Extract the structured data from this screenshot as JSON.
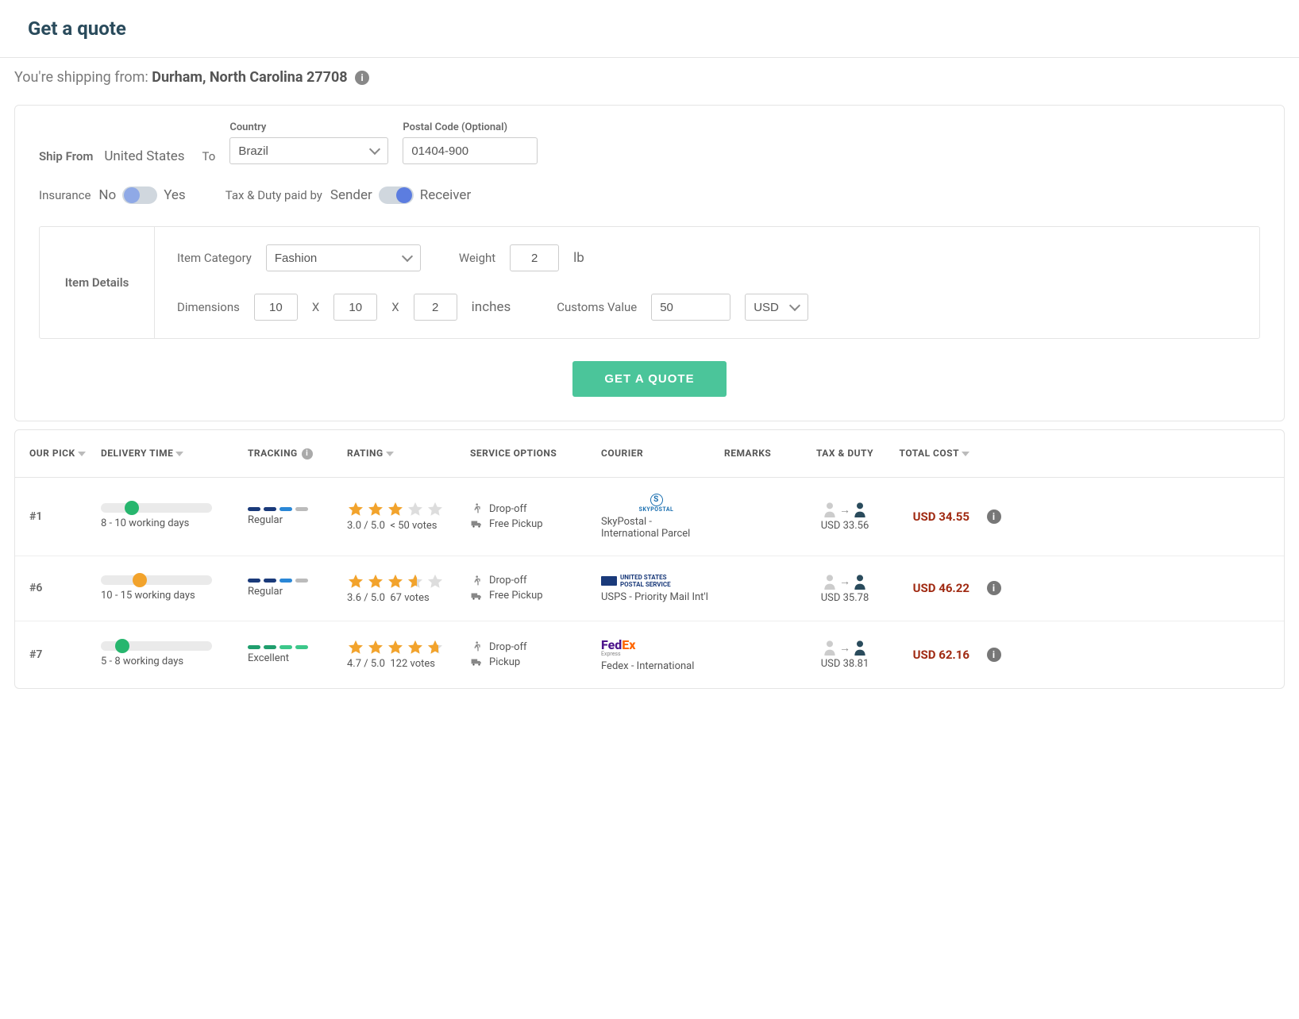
{
  "header": {
    "title": "Get a quote"
  },
  "shipFrom": {
    "prefix": "You're shipping from: ",
    "location": "Durham, North Carolina 27708"
  },
  "form": {
    "shipFromLabel": "Ship From",
    "shipFromValue": "United States",
    "toLabel": "To",
    "countryLabel": "Country",
    "countryValue": "Brazil",
    "postalLabel": "Postal Code (Optional)",
    "postalValue": "01404-900",
    "insuranceLabel": "Insurance",
    "insuranceNo": "No",
    "insuranceYes": "Yes",
    "taxDutyLabel": "Tax & Duty paid by",
    "taxDutySender": "Sender",
    "taxDutyReceiver": "Receiver",
    "itemDetailsLabel": "Item Details",
    "itemCategoryLabel": "Item Category",
    "itemCategoryValue": "Fashion",
    "weightLabel": "Weight",
    "weightValue": "2",
    "weightUnit": "lb",
    "dimensionsLabel": "Dimensions",
    "dimL": "10",
    "dimW": "10",
    "dimH": "2",
    "dimX": "X",
    "dimUnit": "inches",
    "customsValueLabel": "Customs Value",
    "customsValue": "50",
    "currency": "USD",
    "submitLabel": "GET A QUOTE"
  },
  "columns": {
    "pick": "OUR PICK",
    "time": "DELIVERY TIME",
    "tracking": "TRACKING",
    "rating": "RATING",
    "service": "SERVICE OPTIONS",
    "courier": "COURIER",
    "remarks": "REMARKS",
    "tax": "TAX & DUTY",
    "total": "TOTAL COST"
  },
  "rows": [
    {
      "pick": "#1",
      "deliveryText": "8 - 10 working days",
      "timeDotPos": 30,
      "timeDotColor": "#27b66e",
      "trackingSegs": [
        "#1a3a7a",
        "#1a3a7a",
        "#2a87d6",
        "#bbb"
      ],
      "trackingText": "Regular",
      "ratingStars": 3.0,
      "ratingText": "3.0 / 5.0",
      "ratingVotes": "< 50 votes",
      "svc1": "Drop-off",
      "svc2": "Free Pickup",
      "courierLogo": "skypostal",
      "courierName": "SkyPostal - International Parcel",
      "taxAmount": "USD 33.56",
      "total": "USD 34.55"
    },
    {
      "pick": "#6",
      "deliveryText": "10 - 15 working days",
      "timeDotPos": 40,
      "timeDotColor": "#f2a32c",
      "trackingSegs": [
        "#1a3a7a",
        "#1a3a7a",
        "#2a87d6",
        "#bbb"
      ],
      "trackingText": "Regular",
      "ratingStars": 3.6,
      "ratingText": "3.6 / 5.0",
      "ratingVotes": "67 votes",
      "svc1": "Drop-off",
      "svc2": "Free Pickup",
      "courierLogo": "usps",
      "courierName": "USPS - Priority Mail Int'l",
      "taxAmount": "USD 35.78",
      "total": "USD 46.22"
    },
    {
      "pick": "#7",
      "deliveryText": "5 - 8 working days",
      "timeDotPos": 18,
      "timeDotColor": "#27b66e",
      "trackingSegs": [
        "#1f9e6d",
        "#1f9e6d",
        "#3cc78a",
        "#3cc78a"
      ],
      "trackingText": "Excellent",
      "ratingStars": 4.7,
      "ratingText": "4.7 / 5.0",
      "ratingVotes": "122 votes",
      "svc1": "Drop-off",
      "svc2": "Pickup",
      "courierLogo": "fedex",
      "courierName": "Fedex - International",
      "taxAmount": "USD 38.81",
      "total": "USD 62.16"
    }
  ]
}
